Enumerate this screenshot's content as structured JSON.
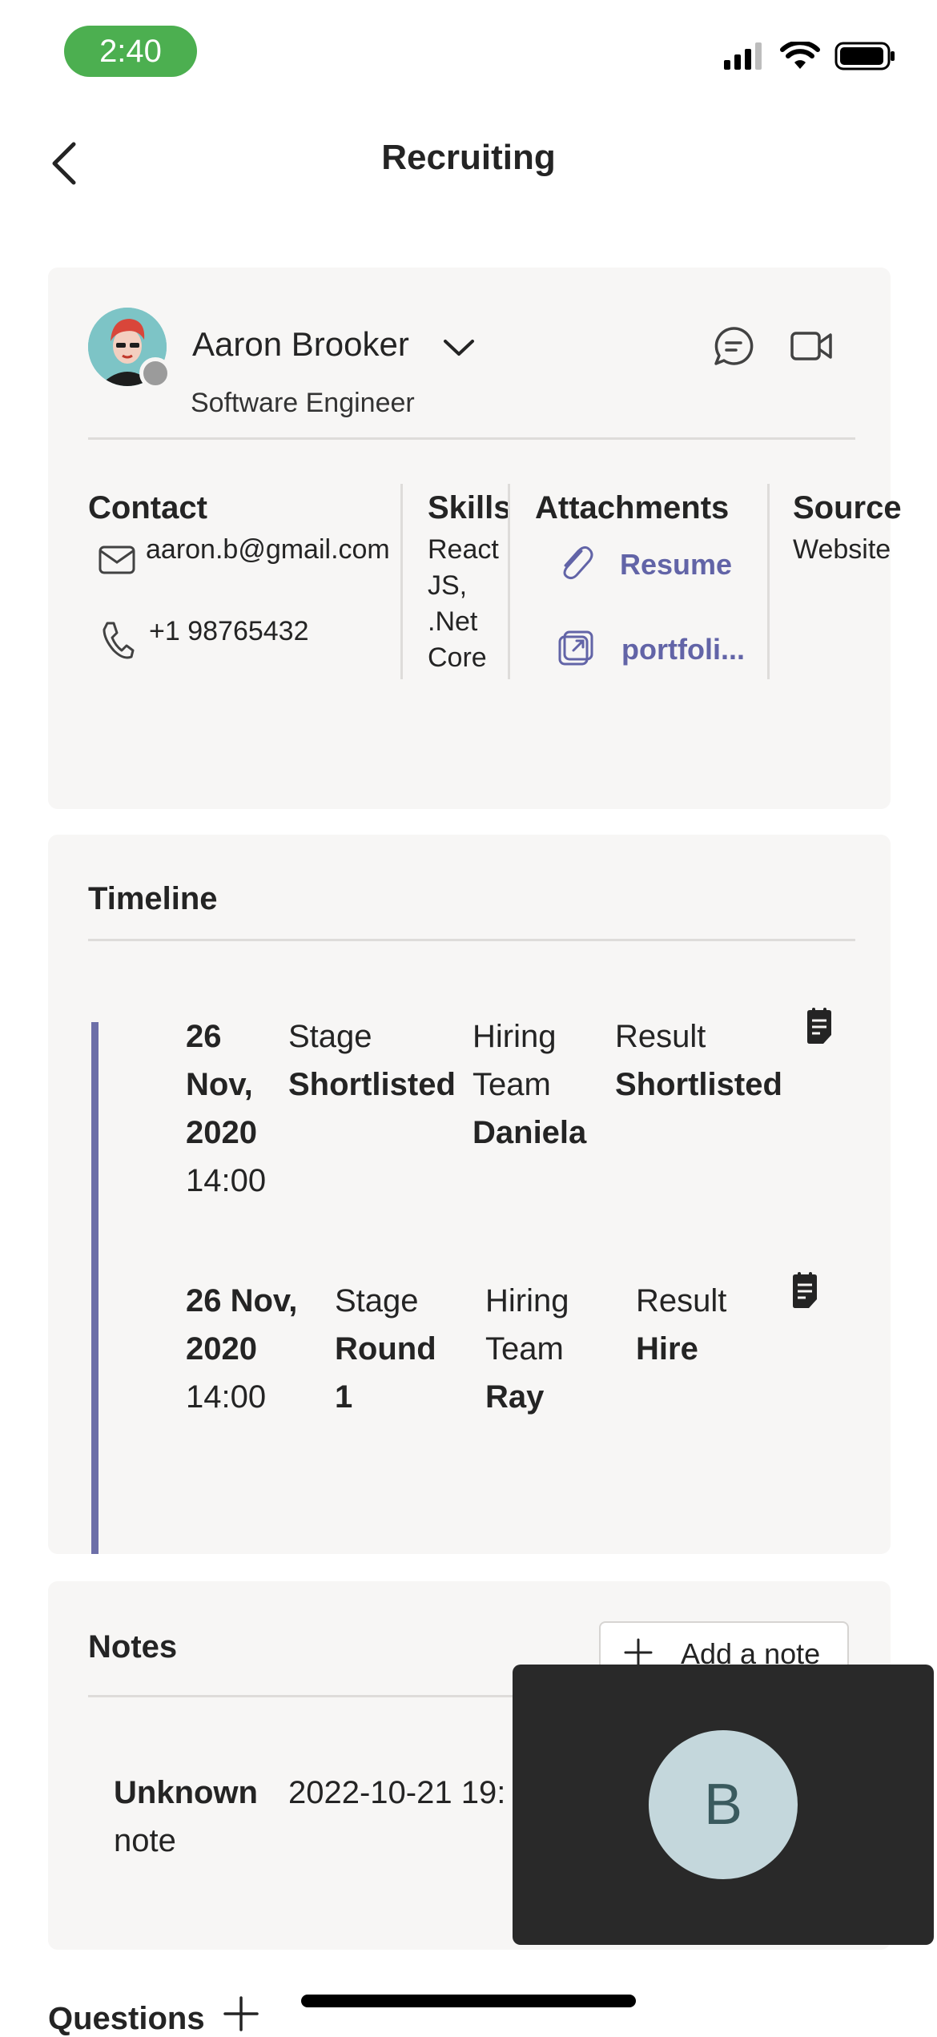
{
  "status_bar": {
    "time": "2:40"
  },
  "nav": {
    "title": "Recruiting"
  },
  "candidate": {
    "name": "Aaron Brooker",
    "role": "Software Engineer",
    "contact_title": "Contact",
    "email": "aaron.b@gmail.com",
    "phone": "+1 98765432",
    "skills_title": "Skills",
    "skills_lines": [
      "React",
      "JS,",
      ".Net",
      "Core"
    ],
    "attachments_title": "Attachments",
    "attachments": [
      "Resume",
      "portfoli..."
    ],
    "source_title": "Source",
    "source_value": "Website"
  },
  "timeline": {
    "title": "Timeline",
    "entries": [
      {
        "date_lines": [
          "26",
          "Nov,",
          "2020"
        ],
        "time": "14:00",
        "stage_label": "Stage",
        "stage_value": "Shortlisted",
        "team_label_lines": [
          "Hiring"
        ],
        "team_label_line2": "Team",
        "team_value": "Daniela",
        "result_label": "Result",
        "result_value": "Shortlisted"
      },
      {
        "date_lines": [
          "26 Nov,",
          "2020"
        ],
        "time": "14:00",
        "stage_label": "Stage",
        "stage_value_lines": [
          "Round",
          "1"
        ],
        "team_label_lines": [
          "Hiring",
          "Team"
        ],
        "team_value": "Ray",
        "result_label": "Result",
        "result_value": "Hire"
      }
    ]
  },
  "notes": {
    "title": "Notes",
    "add_button": "Add a note",
    "items": [
      {
        "author_lines": [
          "Unknown",
          "note"
        ],
        "timestamp": "2022-10-21 19:"
      }
    ]
  },
  "questions": {
    "title": "Questions"
  },
  "call_overlay": {
    "initial": "B"
  }
}
